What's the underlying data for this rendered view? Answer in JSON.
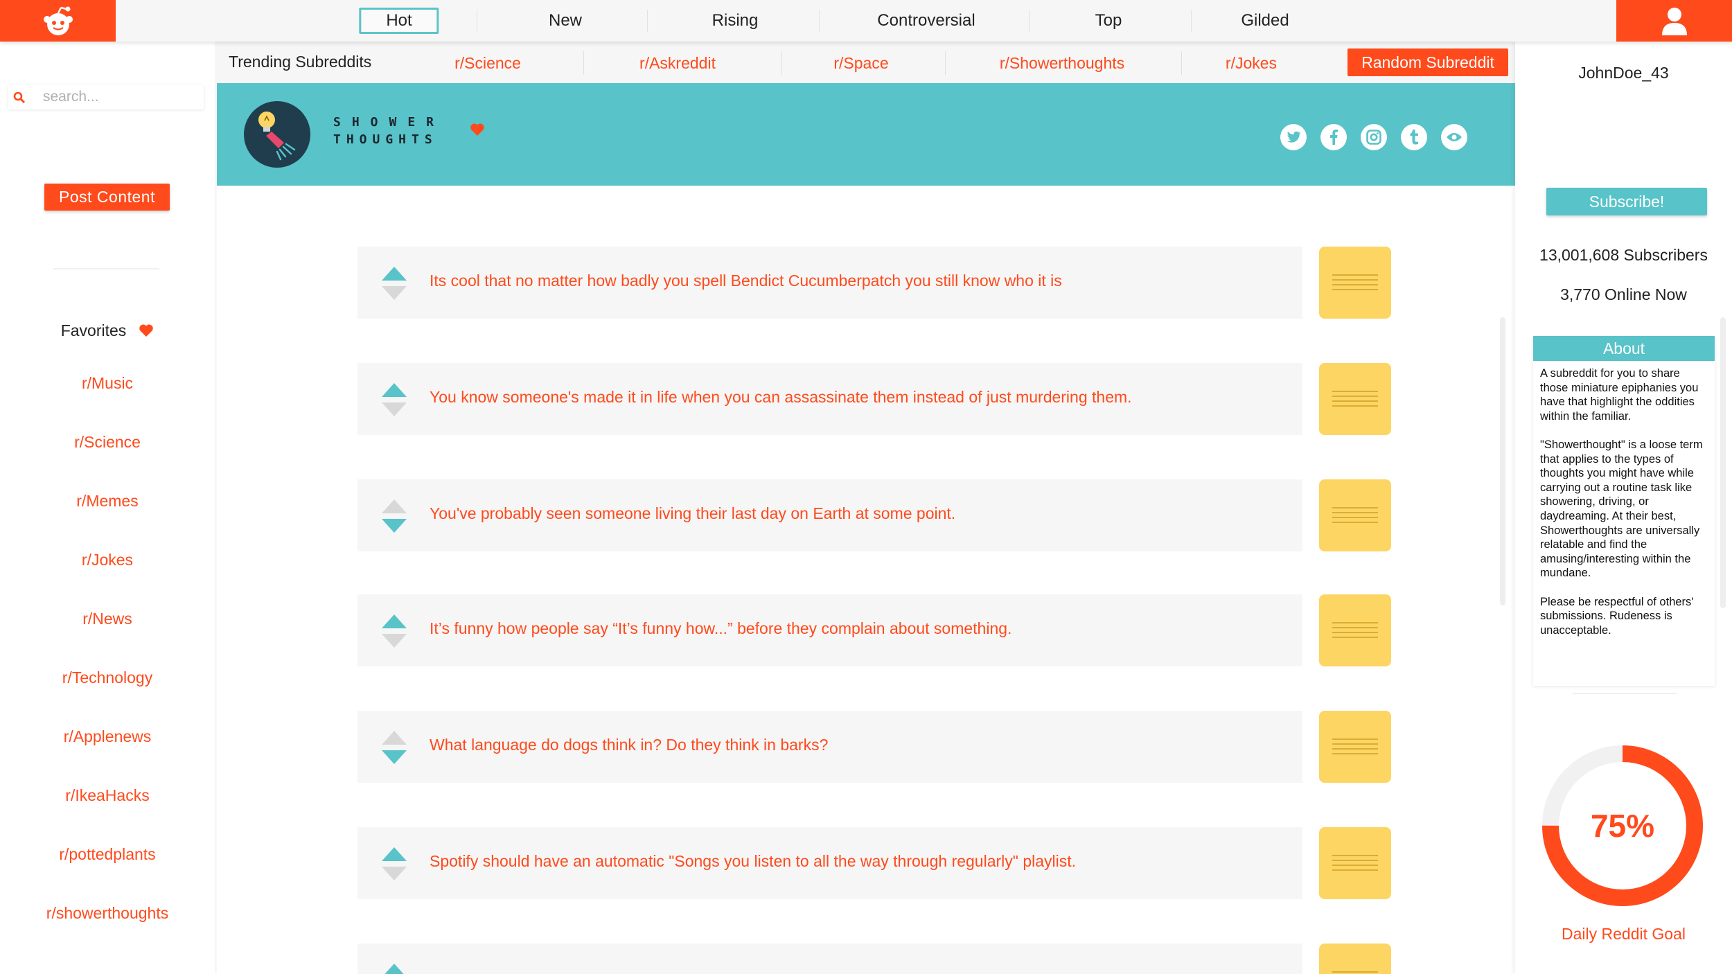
{
  "colors": {
    "brand": "#ff4a1c",
    "teal": "#58c3c8",
    "note": "#fdd562",
    "post_bg": "#f6f6f6"
  },
  "topnav": {
    "tabs": [
      {
        "label": "Hot",
        "active": true
      },
      {
        "label": "New",
        "active": false
      },
      {
        "label": "Rising",
        "active": false
      },
      {
        "label": "Controversial",
        "active": false
      },
      {
        "label": "Top",
        "active": false
      },
      {
        "label": "Gilded",
        "active": false
      }
    ]
  },
  "left": {
    "search_placeholder": "search...",
    "post_label": "Post Content",
    "favorites_title": "Favorites",
    "favorites": [
      "r/Music",
      "r/Science",
      "r/Memes",
      "r/Jokes",
      "r/News",
      "r/Technology",
      "r/Applenews",
      "r/IkeaHacks",
      "r/pottedplants",
      "r/showerthoughts"
    ]
  },
  "trending": {
    "title": "Trending Subreddits",
    "links": [
      "r/Science",
      "r/Askreddit",
      "r/Space",
      "r/Showerthoughts",
      "r/Jokes"
    ],
    "random_label": "Random Subreddit"
  },
  "banner": {
    "name_line1": "SHOWER",
    "name_line2": "THOUGHTS",
    "social_icons": [
      "twitter-icon",
      "facebook-icon",
      "instagram-icon",
      "tumblr-icon",
      "eye-icon"
    ]
  },
  "posts": [
    {
      "title": "Its cool that no matter how badly you spell Bendict Cucumberpatch you still know who it is",
      "vote": "up"
    },
    {
      "title": "You know someone's made it in life when you can assassinate them instead of just murdering them.",
      "vote": "up"
    },
    {
      "title": "You've probably seen someone living their last day on Earth at some point.",
      "vote": "down"
    },
    {
      "title": "It’s funny how people say “It’s funny how...” before they complain about something.",
      "vote": "up"
    },
    {
      "title": "What language do dogs think in? Do they think in barks?",
      "vote": "down"
    },
    {
      "title": "Spotify should have an automatic \"Songs you listen to all the way through regularly\" playlist.",
      "vote": "up"
    },
    {
      "title": "",
      "vote": "up"
    }
  ],
  "right": {
    "username": "JohnDoe_43",
    "subscribe_label": "Subscribe!",
    "subscribers": "13,001,608 Subscribers",
    "online": "3,770 Online Now",
    "about_title": "About",
    "about_paragraphs": [
      "A subreddit for you to share those miniature epiphanies you have that highlight the oddities within the familiar.",
      "\"Showerthought\" is a loose term that applies to the types of thoughts you might have while carrying out a routine task like showering, driving, or daydreaming. At their best, Showerthoughts are universally relatable and find the amusing/interesting within the mundane.",
      "Please be respectful of others' submissions. Rudeness is unacceptable."
    ],
    "goal_percent_label": "75%",
    "goal_fraction": 0.75,
    "goal_label": "Daily Reddit Goal"
  }
}
